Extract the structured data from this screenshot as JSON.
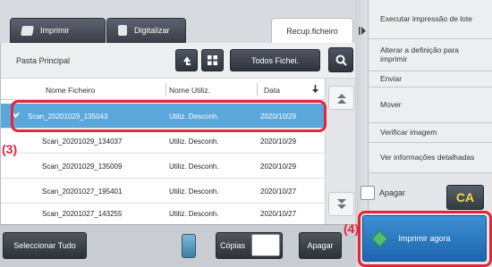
{
  "tabs": [
    {
      "label": "Imprimir"
    },
    {
      "label": "Digitalizar"
    },
    {
      "label": "Recup.ficheiro"
    }
  ],
  "folder": {
    "label": "Pasta Principal",
    "filter_button": "Todos Fichei."
  },
  "columns": [
    "Nome Ficheiro",
    "Nome Utiliz.",
    "Data"
  ],
  "files": [
    {
      "name": "Scan_20201029_135043",
      "user": "Utiliz. Desconh.",
      "date": "2020/10/29"
    },
    {
      "name": "Scan_20201029_134037",
      "user": "Utiliz. Desconh.",
      "date": "2020/10/29"
    },
    {
      "name": "Scan_20201029_135009",
      "user": "Utiliz. Desconh.",
      "date": "2020/10/29"
    },
    {
      "name": "Scan_20201027_195401",
      "user": "Utiliz. Desconh.",
      "date": "2020/10/27"
    },
    {
      "name": "Scan_20201027_143255",
      "user": "Utiliz. Desconh.",
      "date": "2020/10/27"
    }
  ],
  "bottom": {
    "select_all": "Seleccionar Tudo",
    "copies": "Cópias",
    "delete": "Apagar"
  },
  "menu": [
    {
      "label": "Executar impressão de lote"
    },
    {
      "label": "Alterar a definição para imprimir"
    },
    {
      "label": "Enviar"
    },
    {
      "label": "Mover"
    },
    {
      "label": "Verificar imagem"
    },
    {
      "label": "Ver informações detalhadas"
    }
  ],
  "delete_check_label": "Apagar",
  "ca_label": "CA",
  "print_now": "Imprimir agora",
  "callouts": {
    "row": "(3)",
    "print": "(4)"
  },
  "colors": {
    "selected_row": "#5aa7dc",
    "callout": "#e2263a",
    "print_button": "#2a7cc4",
    "ca_text": "#f2d94e"
  },
  "icons": [
    "print-icon",
    "scan-icon",
    "folder-up-icon",
    "grid-view-icon",
    "search-icon",
    "sort-down-icon",
    "scroll-up-icon",
    "scroll-down-icon",
    "chevron-down-icon",
    "collapse-arrow-icon",
    "start-icon"
  ]
}
